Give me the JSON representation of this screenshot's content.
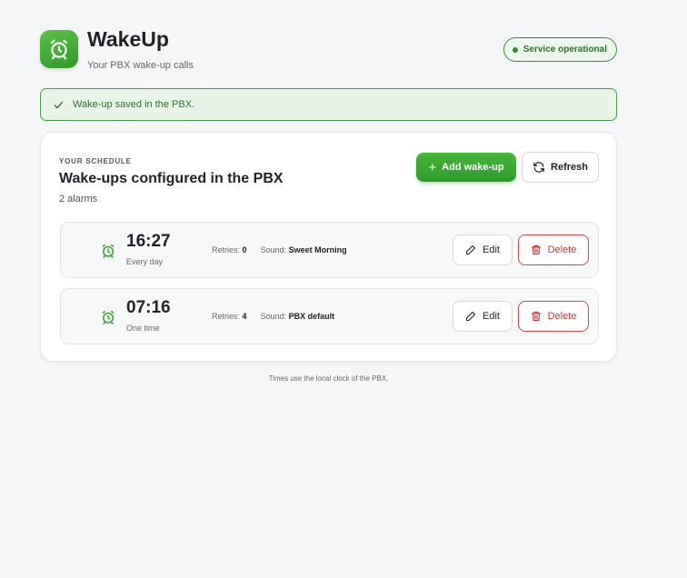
{
  "app": {
    "title": "WakeUp",
    "subtitle": "Your PBX wake-up calls",
    "status": "Service operational"
  },
  "alert": {
    "message": "Wake-up saved in the PBX."
  },
  "schedule": {
    "eyebrow": "YOUR SCHEDULE",
    "title": "Wake-ups configured in the PBX",
    "count": "2 alarms",
    "add_label": "Add wake-up",
    "refresh_label": "Refresh",
    "alarms": [
      {
        "time": "16:27",
        "recurrence": "Every day",
        "retries_label": "Retries:",
        "retries": "0",
        "sound_label": "Sound:",
        "sound": "Sweet Morning",
        "edit_label": "Edit",
        "delete_label": "Delete"
      },
      {
        "time": "07:16",
        "recurrence": "One time",
        "retries_label": "Retries:",
        "retries": "4",
        "sound_label": "Sound:",
        "sound": "PBX default",
        "edit_label": "Edit",
        "delete_label": "Delete"
      }
    ]
  },
  "footer": {
    "note": "Times use the local clock of the PBX."
  },
  "colors": {
    "accent": "#2e9a2a",
    "danger": "#c23a3a",
    "background": "#f5f6f7"
  },
  "icons": {
    "logo": "alarm-clock-icon",
    "alert": "check-icon",
    "add": "plus-icon",
    "refresh": "refresh-icon",
    "alarm": "alarm-clock-icon",
    "edit": "pencil-icon",
    "delete": "trash-icon"
  }
}
